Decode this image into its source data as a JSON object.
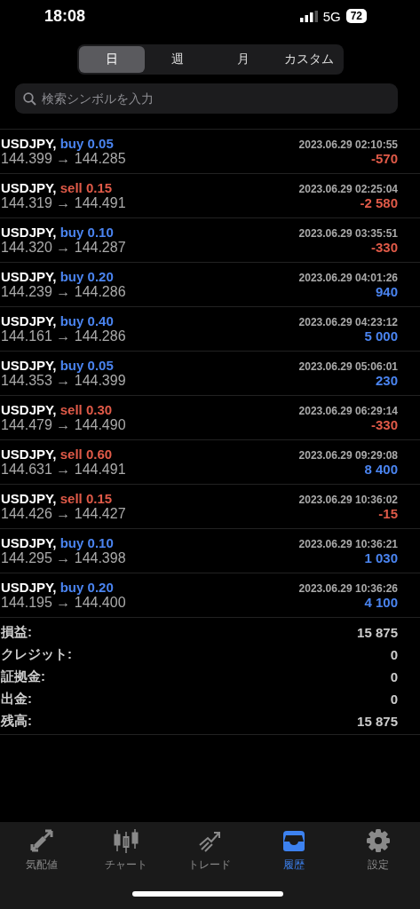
{
  "status_bar": {
    "time": "18:08",
    "network": "5G",
    "battery": "72"
  },
  "period_tabs": [
    {
      "label": "日",
      "selected": true
    },
    {
      "label": "週",
      "selected": false
    },
    {
      "label": "月",
      "selected": false
    },
    {
      "label": "カスタム",
      "selected": false
    }
  ],
  "search": {
    "placeholder": "検索シンボルを入力"
  },
  "trades": [
    {
      "symbol": "USDJPY,",
      "side": {
        "text": "buy 0.05",
        "color": "#4a84f0"
      },
      "time": "2023.06.29 02:10:55",
      "prices": "144.399 → 144.285",
      "profit": {
        "text": "-570",
        "color": "#e05a48"
      }
    },
    {
      "symbol": "USDJPY,",
      "side": {
        "text": "sell 0.15",
        "color": "#e05a48"
      },
      "time": "2023.06.29 02:25:04",
      "prices": "144.319 → 144.491",
      "profit": {
        "text": "-2 580",
        "color": "#e05a48"
      }
    },
    {
      "symbol": "USDJPY,",
      "side": {
        "text": "buy 0.10",
        "color": "#4a84f0"
      },
      "time": "2023.06.29 03:35:51",
      "prices": "144.320 → 144.287",
      "profit": {
        "text": "-330",
        "color": "#e05a48"
      }
    },
    {
      "symbol": "USDJPY,",
      "side": {
        "text": "buy 0.20",
        "color": "#4a84f0"
      },
      "time": "2023.06.29 04:01:26",
      "prices": "144.239 → 144.286",
      "profit": {
        "text": "940",
        "color": "#4a84f0"
      }
    },
    {
      "symbol": "USDJPY,",
      "side": {
        "text": "buy 0.40",
        "color": "#4a84f0"
      },
      "time": "2023.06.29 04:23:12",
      "prices": "144.161 → 144.286",
      "profit": {
        "text": "5 000",
        "color": "#4a84f0"
      }
    },
    {
      "symbol": "USDJPY,",
      "side": {
        "text": "buy 0.05",
        "color": "#4a84f0"
      },
      "time": "2023.06.29 05:06:01",
      "prices": "144.353 → 144.399",
      "profit": {
        "text": "230",
        "color": "#4a84f0"
      }
    },
    {
      "symbol": "USDJPY,",
      "side": {
        "text": "sell 0.30",
        "color": "#e05a48"
      },
      "time": "2023.06.29 06:29:14",
      "prices": "144.479 → 144.490",
      "profit": {
        "text": "-330",
        "color": "#e05a48"
      }
    },
    {
      "symbol": "USDJPY,",
      "side": {
        "text": "sell 0.60",
        "color": "#e05a48"
      },
      "time": "2023.06.29 09:29:08",
      "prices": "144.631 → 144.491",
      "profit": {
        "text": "8 400",
        "color": "#4a84f0"
      }
    },
    {
      "symbol": "USDJPY,",
      "side": {
        "text": "sell 0.15",
        "color": "#e05a48"
      },
      "time": "2023.06.29 10:36:02",
      "prices": "144.426 → 144.427",
      "profit": {
        "text": "-15",
        "color": "#e05a48"
      }
    },
    {
      "symbol": "USDJPY,",
      "side": {
        "text": "buy 0.10",
        "color": "#4a84f0"
      },
      "time": "2023.06.29 10:36:21",
      "prices": "144.295 → 144.398",
      "profit": {
        "text": "1 030",
        "color": "#4a84f0"
      }
    },
    {
      "symbol": "USDJPY,",
      "side": {
        "text": "buy 0.20",
        "color": "#4a84f0"
      },
      "time": "2023.06.29 10:36:26",
      "prices": "144.195 → 144.400",
      "profit": {
        "text": "4 100",
        "color": "#4a84f0"
      }
    }
  ],
  "summary": [
    {
      "label": "損益:",
      "value": "15 875"
    },
    {
      "label": "クレジット:",
      "value": "0"
    },
    {
      "label": "証拠金:",
      "value": "0"
    },
    {
      "label": "出金:",
      "value": "0"
    },
    {
      "label": "残高:",
      "value": "15 875"
    }
  ],
  "tab_bar": [
    {
      "kind": "quotes",
      "label": "気配値",
      "selected": false
    },
    {
      "kind": "chart",
      "label": "チャート",
      "selected": false
    },
    {
      "kind": "trade",
      "label": "トレード",
      "selected": false
    },
    {
      "kind": "history",
      "label": "履歴",
      "selected": true
    },
    {
      "kind": "settings",
      "label": "設定",
      "selected": false
    }
  ]
}
